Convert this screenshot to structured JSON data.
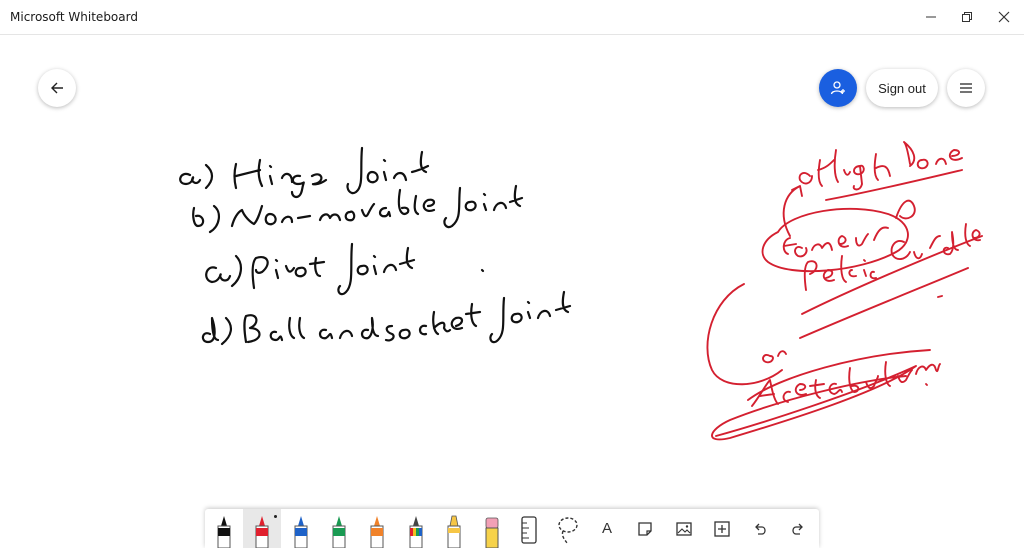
{
  "window": {
    "title": "Microsoft Whiteboard",
    "controls": [
      "minimize-icon",
      "restore-icon",
      "close-icon"
    ]
  },
  "header": {
    "back_icon": "back-arrow-icon",
    "invite_icon": "invite-person-icon",
    "sign_out_label": "Sign out",
    "menu_icon": "hamburger-menu-icon",
    "accent": "#1a5fe0"
  },
  "canvas": {
    "ink_colors": {
      "black": "#111111",
      "red": "#d42030"
    }
  },
  "toolbar": {
    "tools": [
      {
        "name": "pen-black",
        "color": "#111111"
      },
      {
        "name": "pen-red",
        "color": "#e0202e",
        "selected": true
      },
      {
        "name": "pen-blue",
        "color": "#1e62c8"
      },
      {
        "name": "pen-green",
        "color": "#1a9a52"
      },
      {
        "name": "pen-orange",
        "color": "#f0822a"
      },
      {
        "name": "pen-rainbow",
        "color": "#2aa5a0"
      },
      {
        "name": "highlighter",
        "color": "#f6c646"
      },
      {
        "name": "eraser",
        "color": "#f2a0b6"
      },
      {
        "name": "ruler-icon"
      },
      {
        "name": "lasso-select-icon"
      },
      {
        "name": "text-icon",
        "glyph": "A"
      },
      {
        "name": "sticky-note-icon"
      },
      {
        "name": "image-icon"
      },
      {
        "name": "insert-icon"
      },
      {
        "name": "undo-icon"
      },
      {
        "name": "redo-icon"
      }
    ]
  }
}
